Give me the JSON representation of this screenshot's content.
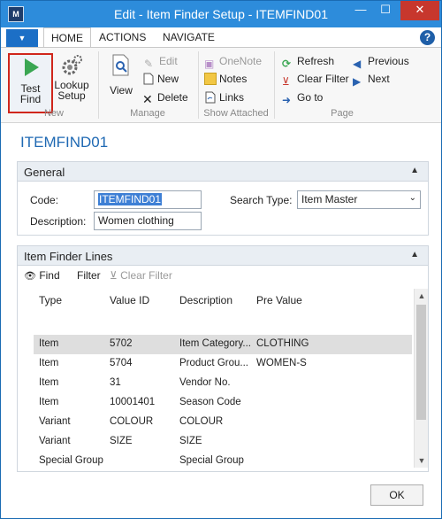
{
  "window": {
    "title": "Edit - Item Finder Setup - ITEMFIND01",
    "min_glyph": "—",
    "max_glyph": "☐",
    "close_glyph": "✕"
  },
  "ribbon": {
    "tabs": [
      "HOME",
      "ACTIONS",
      "NAVIGATE"
    ],
    "new_group": {
      "label": "New",
      "test_find": "Test\nFind",
      "lookup_setup": "Lookup\nSetup"
    },
    "manage_group": {
      "label": "Manage",
      "view": "View",
      "edit": "Edit",
      "new": "New",
      "delete": "Delete"
    },
    "show_attached_group": {
      "label": "Show Attached",
      "onenote": "OneNote",
      "notes": "Notes",
      "links": "Links"
    },
    "page_group": {
      "label": "Page",
      "refresh": "Refresh",
      "clear_filter": "Clear Filter",
      "go_to": "Go to",
      "previous": "Previous",
      "next": "Next"
    }
  },
  "page_title": "ITEMFIND01",
  "general": {
    "header": "General",
    "code_label": "Code:",
    "code_value": "ITEMFIND01",
    "description_label": "Description:",
    "description_value": "Women clothing",
    "search_type_label": "Search Type:",
    "search_type_value": "Item Master"
  },
  "lines": {
    "header": "Item Finder Lines",
    "find": "Find",
    "filter": "Filter",
    "clear_filter": "Clear Filter",
    "columns": [
      "Type",
      "Value ID",
      "Description",
      "Pre Value"
    ],
    "rows": [
      [
        "",
        "",
        "",
        ""
      ],
      [
        "Item",
        "5702",
        "Item Category...",
        "CLOTHING"
      ],
      [
        "Item",
        "5704",
        "Product Grou...",
        "WOMEN-S"
      ],
      [
        "Item",
        "31",
        "Vendor No.",
        ""
      ],
      [
        "Item",
        "10001401",
        "Season Code",
        ""
      ],
      [
        "Variant",
        "COLOUR",
        "COLOUR",
        ""
      ],
      [
        "Variant",
        "SIZE",
        "SIZE",
        ""
      ],
      [
        "Special Group",
        "",
        "Special Group",
        ""
      ]
    ]
  },
  "ok_label": "OK",
  "colors": {
    "titlebar": "#2d8cdb",
    "accent": "#1f69b3",
    "close": "#c7372d",
    "highlight_border": "#d0261b"
  }
}
